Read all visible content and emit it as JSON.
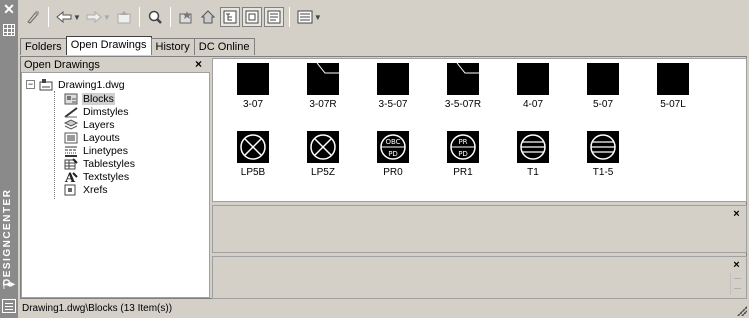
{
  "palette": {
    "title_bar": "#8a8a8a",
    "window": "#d4d0c8",
    "pane": "#ffffff"
  },
  "sidebar": {
    "title": "DESIGNCENTER",
    "icons": [
      "close-icon",
      "properties-icon",
      "autohide-arrows-icon",
      "menu-icon"
    ]
  },
  "toolbar": {
    "buttons": [
      "load-icon",
      "back-icon",
      "forward-icon",
      "up-icon",
      "search-icon",
      "favorites-icon",
      "home-icon",
      "tree-toggle-icon",
      "preview-icon",
      "description-icon",
      "views-icon"
    ]
  },
  "tabs": [
    {
      "label": "Folders",
      "active": false
    },
    {
      "label": "Open Drawings",
      "active": true
    },
    {
      "label": "History",
      "active": false
    },
    {
      "label": "DC Online",
      "active": false
    }
  ],
  "tree": {
    "header": "Open Drawings",
    "close": "×",
    "root": {
      "expander": "−",
      "label": "Drawing1.dwg"
    },
    "children": [
      {
        "label": "Blocks",
        "icon": "blocks-icon",
        "selected": true
      },
      {
        "label": "Dimstyles",
        "icon": "dimstyles-icon",
        "selected": false
      },
      {
        "label": "Layers",
        "icon": "layers-icon",
        "selected": false
      },
      {
        "label": "Layouts",
        "icon": "layouts-icon",
        "selected": false
      },
      {
        "label": "Linetypes",
        "icon": "linetypes-icon",
        "selected": false
      },
      {
        "label": "Tablestyles",
        "icon": "tablestyles-icon",
        "selected": false
      },
      {
        "label": "Textstyles",
        "icon": "textstyles-icon",
        "selected": false
      },
      {
        "label": "Xrefs",
        "icon": "xrefs-icon",
        "selected": false
      }
    ]
  },
  "blocks": [
    {
      "label": "3-07",
      "thumb": "square"
    },
    {
      "label": "3-07R",
      "thumb": "square-diag"
    },
    {
      "label": "3-5-07",
      "thumb": "square"
    },
    {
      "label": "3-5-07R",
      "thumb": "square-diag"
    },
    {
      "label": "4-07",
      "thumb": "square"
    },
    {
      "label": "5-07",
      "thumb": "square"
    },
    {
      "label": "5-07L",
      "thumb": "square"
    },
    {
      "label": "LP5B",
      "thumb": "circle-x"
    },
    {
      "label": "LP5Z",
      "thumb": "circle-x"
    },
    {
      "label": "PR0",
      "thumb": "circle-text",
      "text_top": "OBC",
      "text_bottom": "PD"
    },
    {
      "label": "PR1",
      "thumb": "circle-text",
      "text_top": "PR",
      "text_bottom": "PD"
    },
    {
      "label": "T1",
      "thumb": "circle-lines"
    },
    {
      "label": "T1-5",
      "thumb": "circle-lines"
    }
  ],
  "preview_pane": {
    "close": "×"
  },
  "description_pane": {
    "close": "×"
  },
  "status": "Drawing1.dwg\\Blocks (13 Item(s))"
}
